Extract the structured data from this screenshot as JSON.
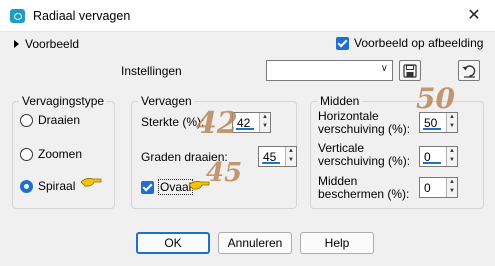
{
  "window": {
    "title": "Radiaal vervagen",
    "close_glyph": "✕",
    "icon": "app-icon"
  },
  "top": {
    "preview_toggle_label": "Voorbeeld",
    "preview_on_image_label": "Voorbeeld op afbeelding",
    "preview_on_image_checked": true,
    "settings_label": "Instellingen",
    "settings_value": "",
    "save_icon": "floppy-disk-icon",
    "reset_icon": "reset-arrow-icon"
  },
  "blur_type": {
    "legend": "Vervagingstype",
    "options": [
      {
        "label": "Draaien",
        "selected": false
      },
      {
        "label": "Zoomen",
        "selected": false
      },
      {
        "label": "Spiraal",
        "selected": true
      }
    ]
  },
  "blur": {
    "legend": "Vervagen",
    "strength_label": "Sterkte (%):",
    "strength_value": "42",
    "rotation_label": "Graden draaien:",
    "rotation_value": "45",
    "oval_label": "Ovaal",
    "oval_checked": true
  },
  "center": {
    "legend": "Midden",
    "horizontal_label_1": "Horizontale",
    "horizontal_label_2": "verschuiving (%):",
    "horizontal_value": "50",
    "vertical_label_1": "Verticale",
    "vertical_label_2": "verschuiving (%):",
    "vertical_value": "0",
    "protect_label_1": "Midden",
    "protect_label_2": "beschermen (%):",
    "protect_value": "0"
  },
  "annotations": {
    "strength": "42",
    "rotation": "45",
    "horizontal": "50"
  },
  "buttons": {
    "ok": "OK",
    "cancel": "Annuleren",
    "help": "Help"
  },
  "colors": {
    "accent": "#1f6fd1",
    "annotation": "#b8885a",
    "pointer": "#f5c400"
  }
}
